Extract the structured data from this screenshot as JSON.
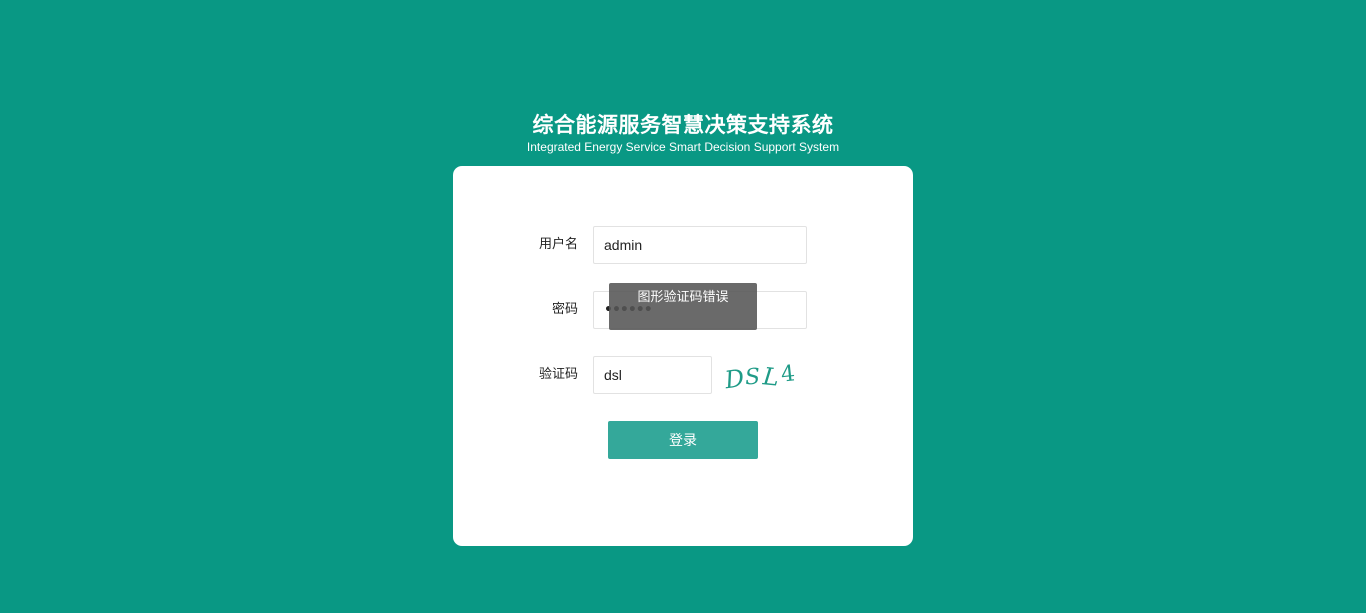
{
  "header": {
    "title": "综合能源服务智慧决策支持系统",
    "subtitle": "Integrated Energy Service Smart Decision Support System"
  },
  "form": {
    "username": {
      "label": "用户名",
      "value": "admin"
    },
    "password": {
      "label": "密码",
      "masked_value": "••••••"
    },
    "captcha": {
      "label": "验证码",
      "value": "dsl",
      "image_text": "DSL4",
      "image_color": "#1f9b87"
    },
    "login_button": "登录"
  },
  "toast": {
    "message": "图形验证码错误"
  },
  "colors": {
    "background": "#099884",
    "button": "#34a89a"
  }
}
